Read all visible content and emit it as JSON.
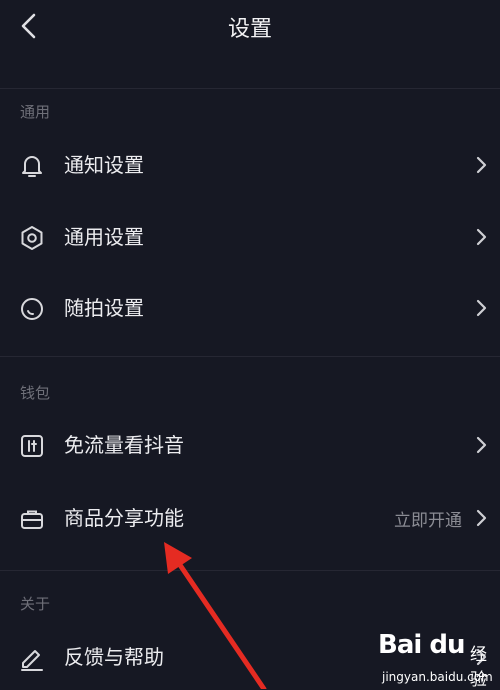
{
  "header": {
    "title": "设置"
  },
  "sections": {
    "general": {
      "label": "通用"
    },
    "wallet": {
      "label": "钱包"
    },
    "about": {
      "label": "关于"
    }
  },
  "items": {
    "notification": {
      "label": "通知设置",
      "icon": "bell-icon"
    },
    "general": {
      "label": "通用设置",
      "icon": "gear-icon"
    },
    "snapshot": {
      "label": "随拍设置",
      "icon": "camera-ring-icon"
    },
    "free_data": {
      "label": "免流量看抖音",
      "icon": "data-card-icon"
    },
    "product_share": {
      "label": "商品分享功能",
      "icon": "briefcase-icon",
      "value": "立即开通"
    },
    "feedback": {
      "label": "反馈与帮助",
      "icon": "pencil-icon"
    }
  },
  "watermark": {
    "logo": "Bai du",
    "logo_jy": "经验",
    "url": "jingyan.baidu.com"
  },
  "colors": {
    "background": "#161823",
    "text": "#ececef",
    "muted": "#6e6f78",
    "annotation_arrow": "#e52b22"
  }
}
